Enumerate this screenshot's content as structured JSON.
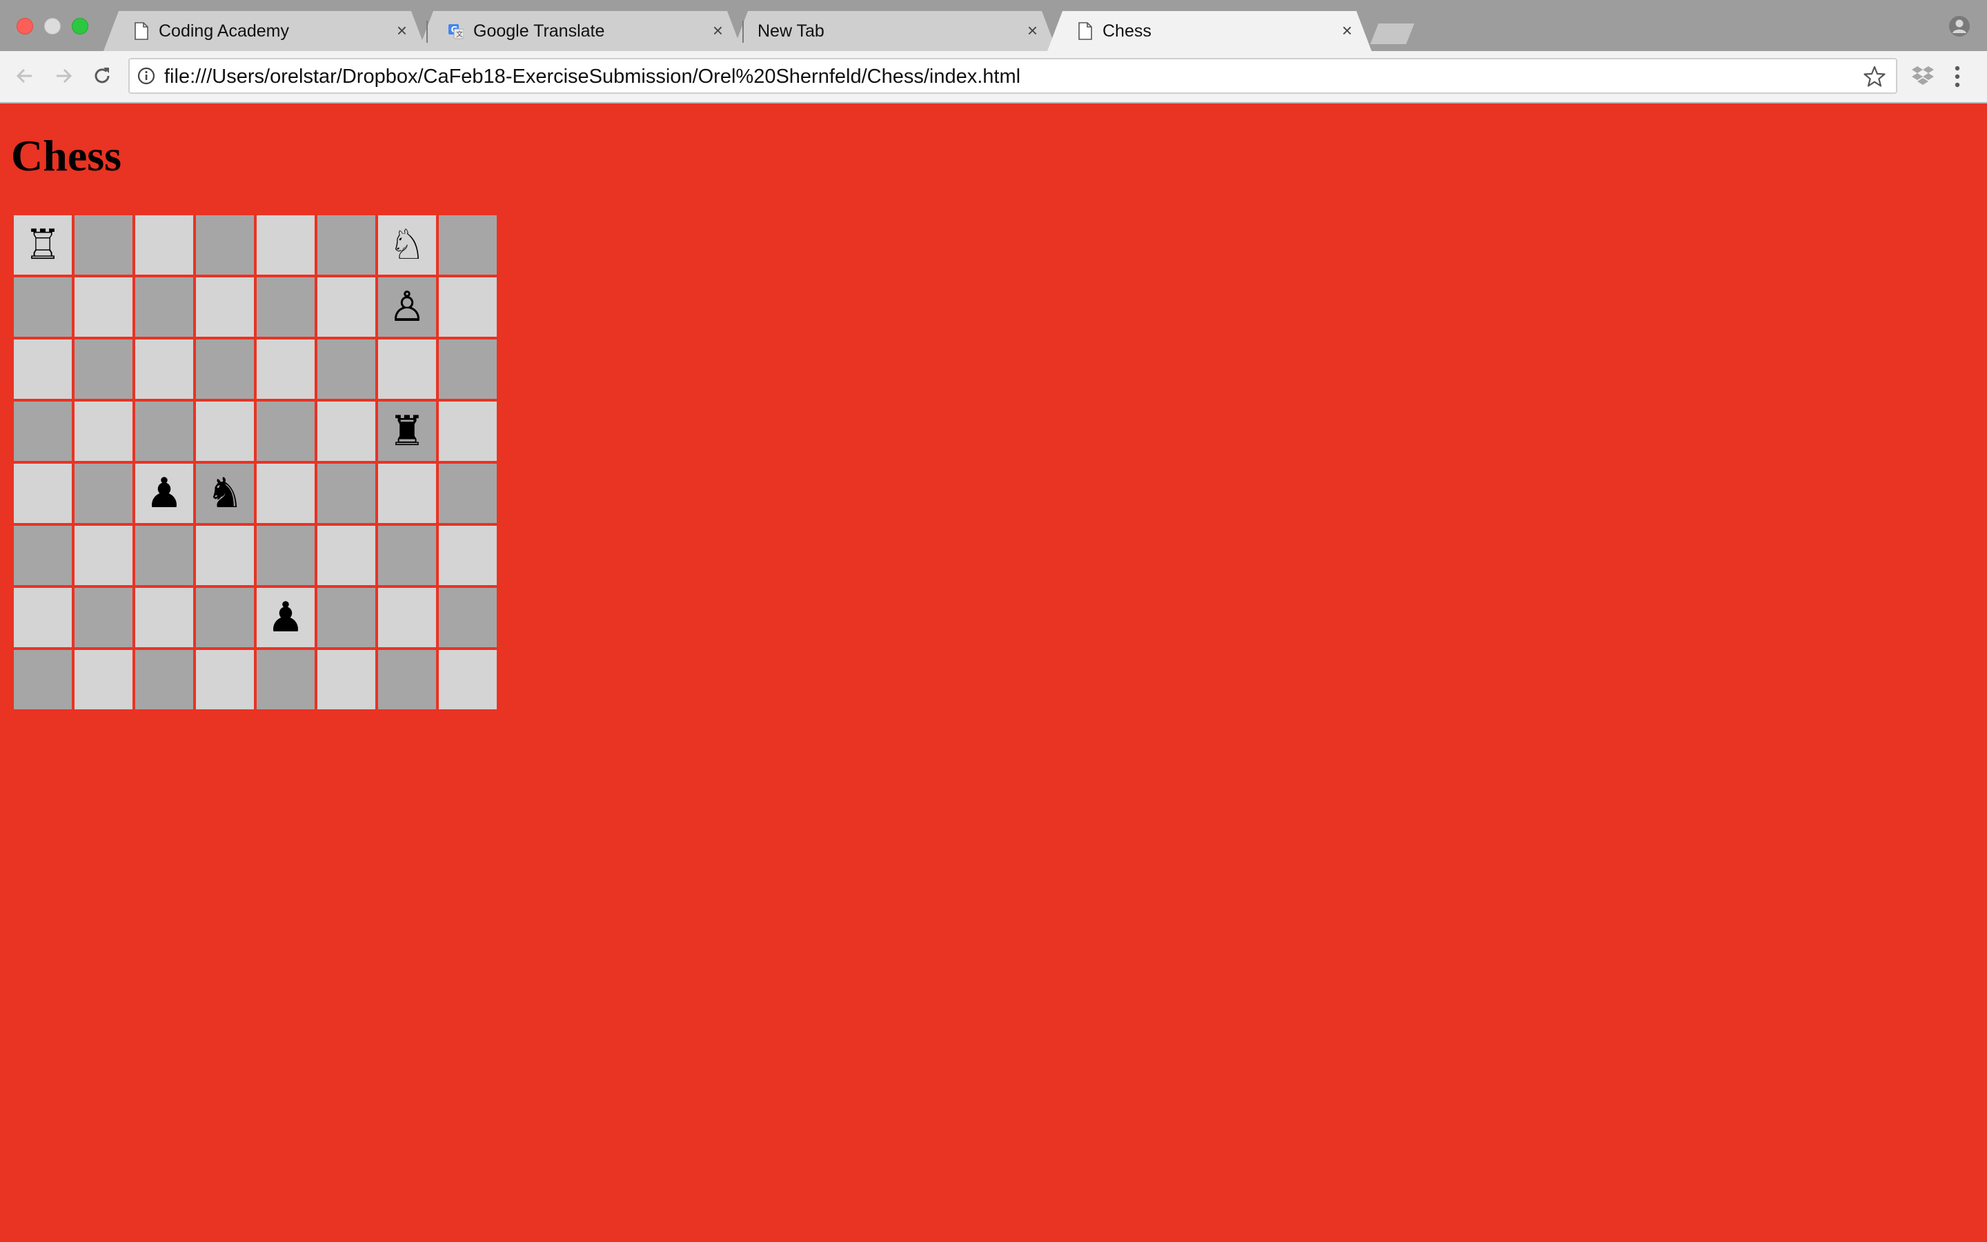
{
  "window": {
    "tabs": [
      {
        "title": "Coding Academy",
        "icon": "page-icon",
        "active": false
      },
      {
        "title": "Google Translate",
        "icon": "google-translate-icon",
        "active": false
      },
      {
        "title": "New Tab",
        "icon": "",
        "active": false
      },
      {
        "title": "Chess",
        "icon": "page-icon",
        "active": true
      }
    ],
    "tab_close_glyph": "×"
  },
  "toolbar": {
    "url": "file:///Users/orelstar/Dropbox/CaFeb18-ExerciseSubmission/Orel%20Shernfeld/Chess/index.html"
  },
  "page": {
    "background_color": "#e93323",
    "title": "Chess",
    "board": {
      "light_square_color": "#d4d4d4",
      "dark_square_color": "#a6a6a6",
      "rows": [
        [
          {
            "piece": "white-rook",
            "glyph": "♖"
          },
          {
            "piece": "",
            "glyph": ""
          },
          {
            "piece": "",
            "glyph": ""
          },
          {
            "piece": "",
            "glyph": ""
          },
          {
            "piece": "",
            "glyph": ""
          },
          {
            "piece": "",
            "glyph": ""
          },
          {
            "piece": "white-knight",
            "glyph": "♘"
          },
          {
            "piece": "",
            "glyph": ""
          }
        ],
        [
          {
            "piece": "",
            "glyph": ""
          },
          {
            "piece": "",
            "glyph": ""
          },
          {
            "piece": "",
            "glyph": ""
          },
          {
            "piece": "",
            "glyph": ""
          },
          {
            "piece": "",
            "glyph": ""
          },
          {
            "piece": "",
            "glyph": ""
          },
          {
            "piece": "white-pawn",
            "glyph": "♙"
          },
          {
            "piece": "",
            "glyph": ""
          }
        ],
        [
          {
            "piece": "",
            "glyph": ""
          },
          {
            "piece": "",
            "glyph": ""
          },
          {
            "piece": "",
            "glyph": ""
          },
          {
            "piece": "",
            "glyph": ""
          },
          {
            "piece": "",
            "glyph": ""
          },
          {
            "piece": "",
            "glyph": ""
          },
          {
            "piece": "",
            "glyph": ""
          },
          {
            "piece": "",
            "glyph": ""
          }
        ],
        [
          {
            "piece": "",
            "glyph": ""
          },
          {
            "piece": "",
            "glyph": ""
          },
          {
            "piece": "",
            "glyph": ""
          },
          {
            "piece": "",
            "glyph": ""
          },
          {
            "piece": "",
            "glyph": ""
          },
          {
            "piece": "",
            "glyph": ""
          },
          {
            "piece": "black-rook",
            "glyph": "♜"
          },
          {
            "piece": "",
            "glyph": ""
          }
        ],
        [
          {
            "piece": "",
            "glyph": ""
          },
          {
            "piece": "",
            "glyph": ""
          },
          {
            "piece": "black-pawn",
            "glyph": "♟"
          },
          {
            "piece": "black-knight",
            "glyph": "♞"
          },
          {
            "piece": "",
            "glyph": ""
          },
          {
            "piece": "",
            "glyph": ""
          },
          {
            "piece": "",
            "glyph": ""
          },
          {
            "piece": "",
            "glyph": ""
          }
        ],
        [
          {
            "piece": "",
            "glyph": ""
          },
          {
            "piece": "",
            "glyph": ""
          },
          {
            "piece": "",
            "glyph": ""
          },
          {
            "piece": "",
            "glyph": ""
          },
          {
            "piece": "",
            "glyph": ""
          },
          {
            "piece": "",
            "glyph": ""
          },
          {
            "piece": "",
            "glyph": ""
          },
          {
            "piece": "",
            "glyph": ""
          }
        ],
        [
          {
            "piece": "",
            "glyph": ""
          },
          {
            "piece": "",
            "glyph": ""
          },
          {
            "piece": "",
            "glyph": ""
          },
          {
            "piece": "",
            "glyph": ""
          },
          {
            "piece": "black-pawn",
            "glyph": "♟"
          },
          {
            "piece": "",
            "glyph": ""
          },
          {
            "piece": "",
            "glyph": ""
          },
          {
            "piece": "",
            "glyph": ""
          }
        ],
        [
          {
            "piece": "",
            "glyph": ""
          },
          {
            "piece": "",
            "glyph": ""
          },
          {
            "piece": "",
            "glyph": ""
          },
          {
            "piece": "",
            "glyph": ""
          },
          {
            "piece": "",
            "glyph": ""
          },
          {
            "piece": "",
            "glyph": ""
          },
          {
            "piece": "",
            "glyph": ""
          },
          {
            "piece": "",
            "glyph": ""
          }
        ]
      ]
    }
  }
}
